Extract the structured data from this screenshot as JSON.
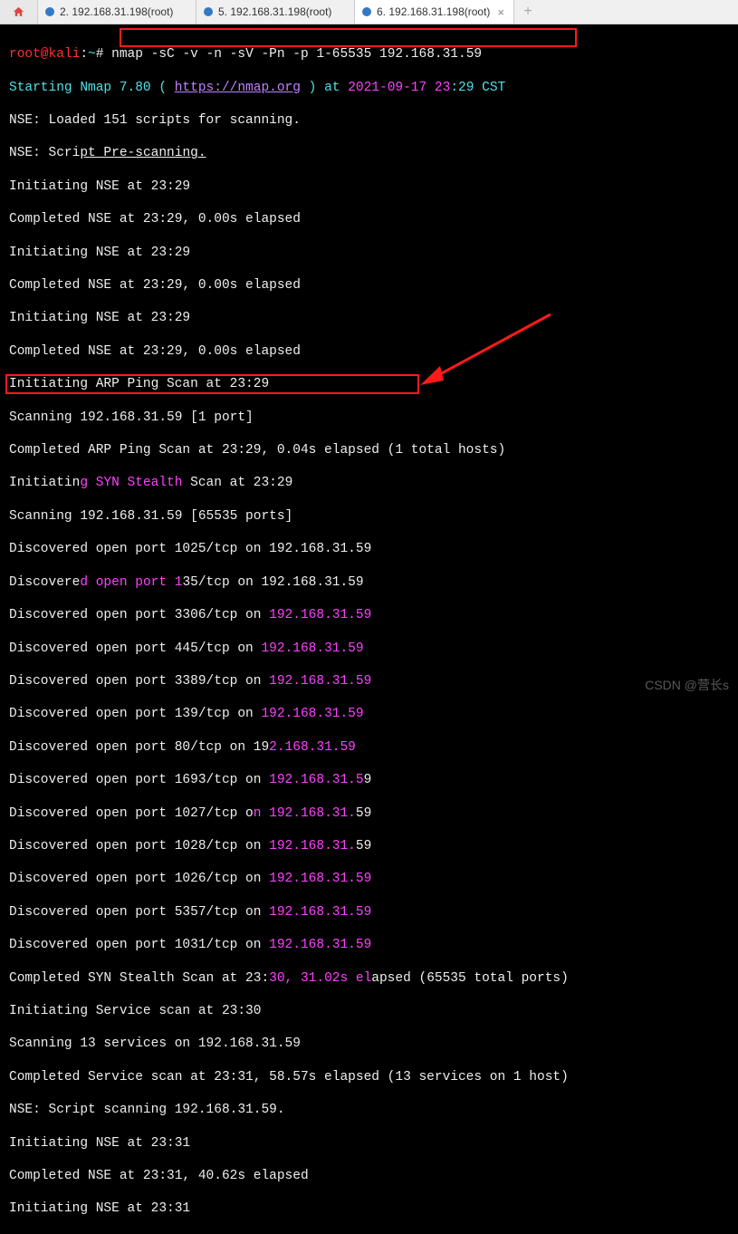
{
  "tabs": [
    {
      "label": "2. 192.168.31.198(root)",
      "active": false
    },
    {
      "label": "5. 192.168.31.198(root)",
      "active": false
    },
    {
      "label": "6. 192.168.31.198(root)",
      "active": true
    }
  ],
  "prompt": {
    "userhost": "root@kali",
    "path": "~",
    "cmd": "nmap -sC -v -n -sV -Pn -p 1-65535 192.168.31.59"
  },
  "lines": {
    "start1": "Starting Nmap 7.80 ( ",
    "url": "https://nmap.org",
    "start2": " ) at ",
    "date": "2021-09-17 23",
    "start3": ":29 CST",
    "l2": "NSE: Loaded 151 scripts for scanning.",
    "l3a": "NSE: Scri",
    "l3b": "pt Pre-scanning.",
    "l4": "Initiating NSE at 23:29",
    "l5": "Completed NSE at 23:29, 0.00s elapsed",
    "l6": "Initiating NSE at 23:29",
    "l7": "Completed NSE at 23:29, 0.00s elapsed",
    "l8": "Initiating NSE at 23:29",
    "l9": "Completed NSE at 23:29, 0.00s elapsed",
    "l10": "Initiating ARP Ping Scan at 23:29",
    "l11": "Scanning 192.168.31.59 [1 port]",
    "l12": "Completed ARP Ping Scan at 23:29, 0.04s elapsed (1 total hosts)",
    "l13a": "Initiatin",
    "l13b": "g SYN Stealth",
    "l13c": " Scan at 23:29",
    "l14": "Scanning 192.168.31.59 [65535 ports]",
    "l15": "Discovered open port 1025/tcp on 192.168.31.59",
    "l16a": "Discovere",
    "l16b": "d open port 1",
    "l16c": "35/tcp on 192.168.31.59",
    "l17a": "Discovered open port 3306/tcp on ",
    "l17b": "192.168.31.59",
    "l18a": "Discovered open port 445/tcp on ",
    "l18b": "192.168.31.59",
    "l19a": "Discovered open port 3389/tcp on ",
    "l19b": "192.168.31.59",
    "l20a": "Discovered open port 139/tcp on ",
    "l20b": "192.168.31.59",
    "l21a": "Discovered open port 80/tcp on 19",
    "l21b": "2.168.31.59",
    "l22a": "Discovered open port 1693/tcp on ",
    "l22b": "192.168.31.5",
    "l22c": "9",
    "l23a": "Discovered open port 1027/tcp o",
    "l23b": "n 192.168.31.",
    "l23c": "59",
    "l24a": "Discovered open port 1028/tcp on ",
    "l24b": "192.168.31.",
    "l24c": "59",
    "l25a": "Discovered open port 1026/tcp on ",
    "l25b": "192.168.31.59",
    "l26a": "Discovered open port 5357/tcp on ",
    "l26b": "192.168.31.59",
    "l27a": "Discovered open port 1031/tcp on ",
    "l27b": "192.168.31.59",
    "l28a": "Completed SYN Stealth Scan at 23:",
    "l28b": "30, 31.02s el",
    "l28c": "apsed (65535 total ports)",
    "l29": "Initiating Service scan at 23:30",
    "l30": "Scanning 13 services on 192.168.31.59",
    "l31": "Completed Service scan at 23:31, 58.57s elapsed (13 services on 1 host)",
    "l32": "NSE: Script scanning 192.168.31.59.",
    "l33": "Initiating NSE at 23:31",
    "l34": "Completed NSE at 23:31, 40.62s elapsed",
    "l35": "Initiating NSE at 23:31"
  },
  "watermark": "CSDN @营长s",
  "icons": {
    "close": "×",
    "add": "+"
  }
}
